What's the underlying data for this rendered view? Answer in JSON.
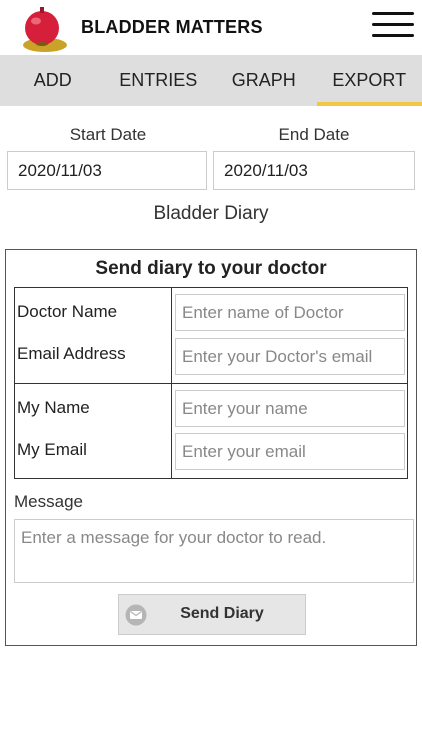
{
  "header": {
    "title": "BLADDER MATTERS"
  },
  "tabs": [
    {
      "label": "ADD"
    },
    {
      "label": "ENTRIES"
    },
    {
      "label": "GRAPH"
    },
    {
      "label": "EXPORT",
      "active": true
    }
  ],
  "dates": {
    "start_label": "Start Date",
    "start_value": "2020/11/03",
    "end_label": "End Date",
    "end_value": "2020/11/03"
  },
  "diary_title": "Bladder Diary",
  "form": {
    "title": "Send diary to your doctor",
    "doctor_name_label": "Doctor Name",
    "doctor_name_placeholder": "Enter name of Doctor",
    "email_label": "Email Address",
    "email_placeholder": "Enter your Doctor's email",
    "my_name_label": "My Name",
    "my_name_placeholder": "Enter your name",
    "my_email_label": "My Email",
    "my_email_placeholder": "Enter your email",
    "message_label": "Message",
    "message_placeholder": "Enter a message for your doctor to read.",
    "send_label": "Send Diary"
  },
  "colors": {
    "accent": "#f2c744",
    "tab_bar": "#dedede",
    "logo": "#d61f3a"
  }
}
